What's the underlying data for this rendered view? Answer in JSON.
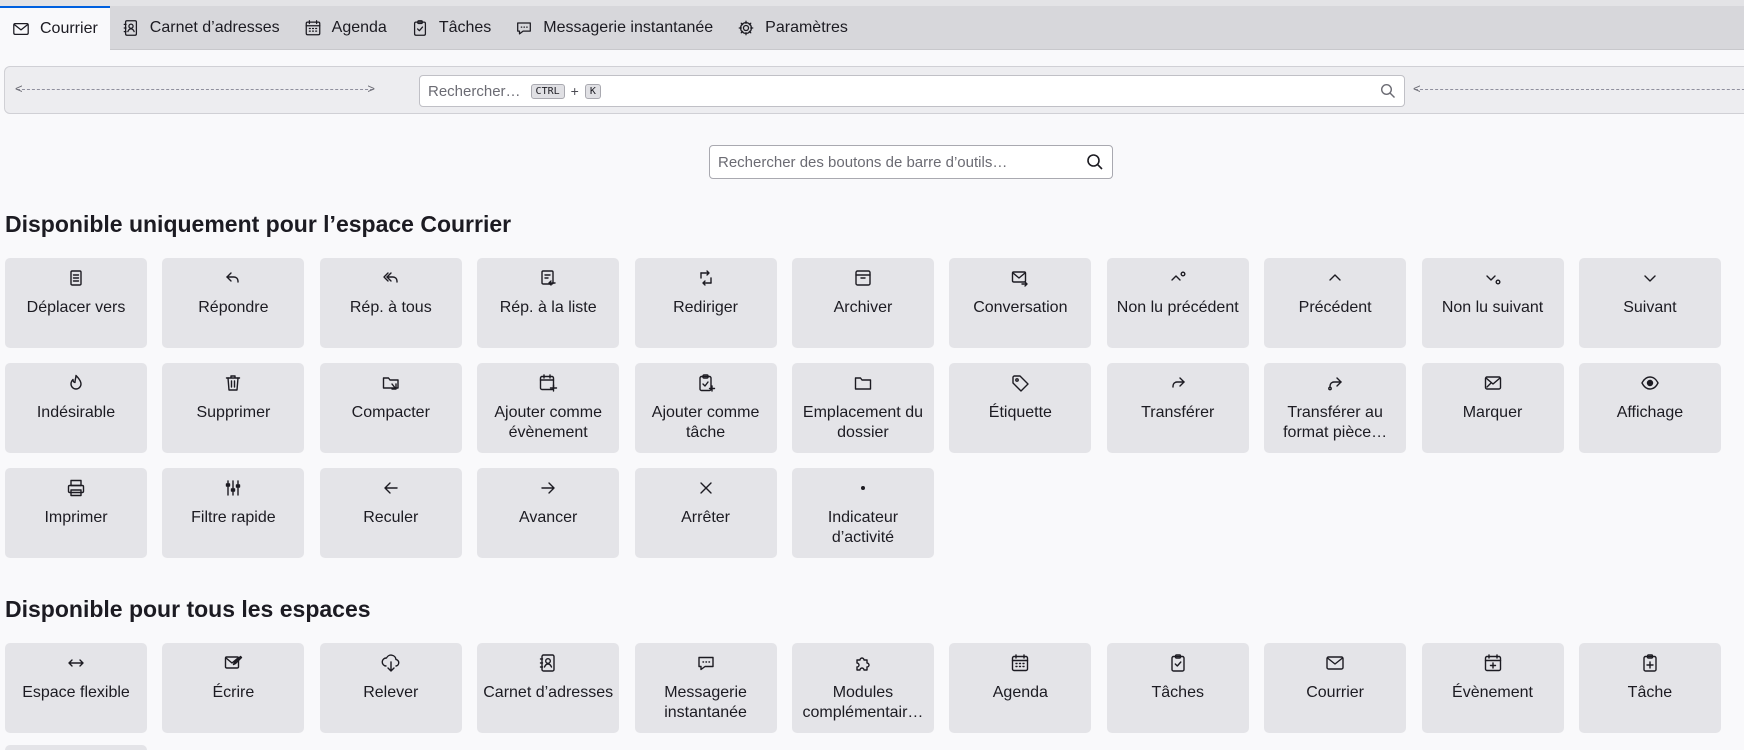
{
  "tabs": [
    {
      "label": "Courrier",
      "icon": "mail-icon"
    },
    {
      "label": "Carnet d’adresses",
      "icon": "address-book-icon"
    },
    {
      "label": "Agenda",
      "icon": "calendar-icon"
    },
    {
      "label": "Tâches",
      "icon": "tasks-icon"
    },
    {
      "label": "Messagerie instantanée",
      "icon": "chat-icon"
    },
    {
      "label": "Paramètres",
      "icon": "gear-icon"
    }
  ],
  "global_search": {
    "placeholder": "Rechercher…",
    "shortcut_key1": "CTRL",
    "shortcut_plus": "+",
    "shortcut_key2": "K"
  },
  "button_search": {
    "placeholder": "Rechercher des boutons de barre d’outils…"
  },
  "section_mail": {
    "title": "Disponible uniquement pour l’espace Courrier",
    "buttons": [
      {
        "label": "Déplacer vers",
        "icon": "move-to-icon"
      },
      {
        "label": "Répondre",
        "icon": "reply-icon"
      },
      {
        "label": "Rép. à tous",
        "icon": "reply-all-icon"
      },
      {
        "label": "Rép. à la liste",
        "icon": "reply-list-icon"
      },
      {
        "label": "Rediriger",
        "icon": "redirect-icon"
      },
      {
        "label": "Archiver",
        "icon": "archive-icon"
      },
      {
        "label": "Conversation",
        "icon": "conversation-icon"
      },
      {
        "label": "Non lu précédent",
        "icon": "previous-unread-icon"
      },
      {
        "label": "Précédent",
        "icon": "chevron-up-icon"
      },
      {
        "label": "Non lu suivant",
        "icon": "next-unread-icon"
      },
      {
        "label": "Suivant",
        "icon": "chevron-down-icon"
      },
      {
        "label": "Indésirable",
        "icon": "junk-icon"
      },
      {
        "label": "Supprimer",
        "icon": "trash-icon"
      },
      {
        "label": "Compacter",
        "icon": "compact-icon"
      },
      {
        "label": "Ajouter comme évènement",
        "icon": "add-event-icon"
      },
      {
        "label": "Ajouter comme tâche",
        "icon": "add-task-icon"
      },
      {
        "label": "Emplacement du dossier",
        "icon": "folder-icon"
      },
      {
        "label": "Étiquette",
        "icon": "tag-icon"
      },
      {
        "label": "Transférer",
        "icon": "forward-icon"
      },
      {
        "label": "Transférer au format pièce…",
        "icon": "forward-attachment-icon"
      },
      {
        "label": "Marquer",
        "icon": "mark-icon"
      },
      {
        "label": "Affichage",
        "icon": "eye-icon"
      },
      {
        "label": "Imprimer",
        "icon": "printer-icon"
      },
      {
        "label": "Filtre rapide",
        "icon": "quick-filter-icon"
      },
      {
        "label": "Reculer",
        "icon": "arrow-left-icon"
      },
      {
        "label": "Avancer",
        "icon": "arrow-right-icon"
      },
      {
        "label": "Arrêter",
        "icon": "stop-icon"
      },
      {
        "label": "Indicateur d’activité",
        "icon": "activity-dot-icon"
      }
    ]
  },
  "section_all": {
    "title": "Disponible pour tous les espaces",
    "buttons": [
      {
        "label": "Espace flexible",
        "icon": "flexible-space-icon"
      },
      {
        "label": "Écrire",
        "icon": "compose-icon"
      },
      {
        "label": "Relever",
        "icon": "get-messages-icon"
      },
      {
        "label": "Carnet d’adresses",
        "icon": "address-book-icon"
      },
      {
        "label": "Messagerie instantanée",
        "icon": "chat-icon"
      },
      {
        "label": "Modules complémentair…",
        "icon": "puzzle-icon"
      },
      {
        "label": "Agenda",
        "icon": "calendar-icon"
      },
      {
        "label": "Tâches",
        "icon": "tasks-icon"
      },
      {
        "label": "Courrier",
        "icon": "mail-icon"
      },
      {
        "label": "Évènement",
        "icon": "new-event-icon"
      },
      {
        "label": "Tâche",
        "icon": "new-task-icon"
      }
    ]
  }
}
